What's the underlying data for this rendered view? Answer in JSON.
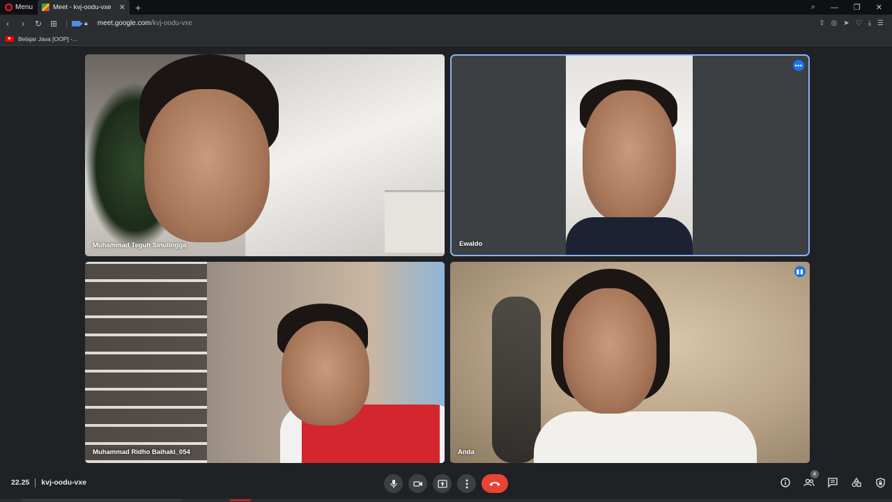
{
  "browser": {
    "menu_label": "Menu",
    "tab_title": "Meet - kvj-oodu-vxe",
    "url_domain": "meet.google.com",
    "url_path": "/kvj-oodu-vxe",
    "bookmark_label": "Belajar Java [OOP] -..."
  },
  "participants": [
    {
      "name": "Muhammad Teguh Sinulingga"
    },
    {
      "name": "Ewaldo"
    },
    {
      "name": "Muhammad Ridho Baihaki_054"
    },
    {
      "name": "Anda"
    }
  ],
  "controls": {
    "time": "22.25",
    "meeting_code": "kvj-oodu-vxe",
    "people_count": "4"
  },
  "icons": {
    "tile_more": "more-options-icon",
    "speaking": "speaking-indicator-icon"
  },
  "colors": {
    "accent": "#8ab4f8",
    "hangup": "#ea4335",
    "background": "#202124"
  }
}
